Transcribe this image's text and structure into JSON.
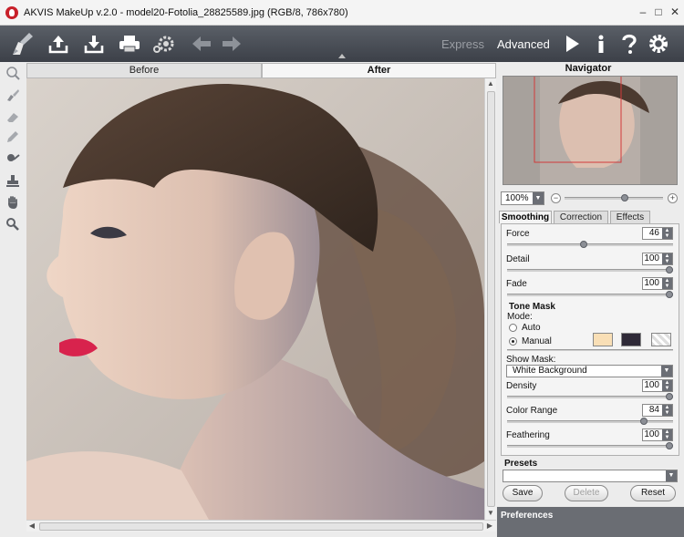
{
  "window": {
    "title": "AKVIS MakeUp v.2.0 - model20-Fotolia_28825589.jpg (RGB/8, 786x780)",
    "minimize_glyph": "–",
    "maximize_glyph": "□",
    "close_glyph": "✕"
  },
  "toolbar": {
    "icons": [
      "brush-logo-icon",
      "open-icon",
      "save-icon",
      "print-icon",
      "batch-gear-icon",
      "undo-arrow-icon",
      "redo-arrow-icon",
      "run-icon",
      "info-icon",
      "help-icon",
      "settings-icon"
    ],
    "mode_express": "Express",
    "mode_advanced": "Advanced",
    "active_mode": "Advanced"
  },
  "tools": [
    "healing-brush-icon",
    "smoothing-brush-icon",
    "eraser-icon",
    "pencil-icon",
    "eyedropper-icon",
    "stamp-icon",
    "hand-icon",
    "zoom-icon"
  ],
  "canvas": {
    "tab_before": "Before",
    "tab_after": "After",
    "active_tab": "After",
    "image_alt": "Portrait of a woman in profile with hair tied back"
  },
  "navigator": {
    "header": "Navigator",
    "zoom_value": "100%",
    "zoom_level_fraction": 0.62,
    "minus_glyph": "−",
    "plus_glyph": "+"
  },
  "settings_tabs": {
    "smoothing": "Smoothing",
    "correction": "Correction",
    "effects": "Effects",
    "active": "Smoothing"
  },
  "smoothing": {
    "force": {
      "label": "Force",
      "value": "46",
      "fraction": 0.46
    },
    "detail": {
      "label": "Detail",
      "value": "100",
      "fraction": 1.0
    },
    "fade": {
      "label": "Fade",
      "value": "100",
      "fraction": 1.0
    }
  },
  "tone_mask": {
    "title": "Tone Mask",
    "mode_label": "Mode:",
    "auto_label": "Auto",
    "manual_label": "Manual",
    "selected_mode": "Manual",
    "swatch_colors": [
      "#f9dfb6",
      "#2f2a38",
      "#e8e8e8"
    ],
    "show_mask_label": "Show Mask:",
    "show_mask_value": "White Background",
    "density": {
      "label": "Density",
      "value": "100",
      "fraction": 1.0
    },
    "color_range": {
      "label": "Color Range",
      "value": "84",
      "fraction": 0.84
    },
    "feathering": {
      "label": "Feathering",
      "value": "100",
      "fraction": 1.0
    }
  },
  "presets": {
    "label": "Presets",
    "selected": "",
    "save_label": "Save",
    "delete_label": "Delete",
    "reset_label": "Reset"
  },
  "preferences": {
    "label": "Preferences"
  },
  "colors": {
    "toolbar_bg": "#4a4e56",
    "accent_white": "#ffffff",
    "inactive_mode": "#9a9da3"
  }
}
